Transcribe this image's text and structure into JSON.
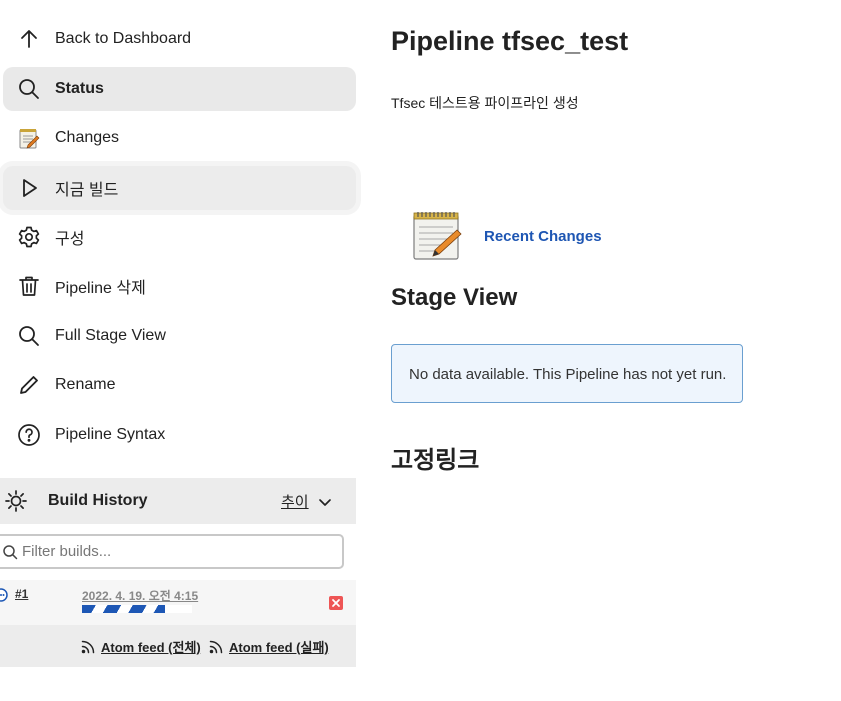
{
  "sidebar": {
    "items": [
      {
        "label": "Back to Dashboard",
        "icon": "arrow-up-icon"
      },
      {
        "label": "Status",
        "icon": "search-icon"
      },
      {
        "label": "Changes",
        "icon": "notepad-icon"
      },
      {
        "label": "지금 빌드",
        "icon": "play-icon"
      },
      {
        "label": "구성",
        "icon": "gear-icon"
      },
      {
        "label": "Pipeline 삭제",
        "icon": "trash-icon"
      },
      {
        "label": "Full Stage View",
        "icon": "search-icon"
      },
      {
        "label": "Rename",
        "icon": "pencil-icon"
      },
      {
        "label": "Pipeline Syntax",
        "icon": "help-icon"
      }
    ]
  },
  "build_history": {
    "title": "Build History",
    "trend_label": "추이",
    "filter_placeholder": "Filter builds...",
    "builds": [
      {
        "number": "#1",
        "date": "2022. 4. 19. 오전 4:15",
        "progress": 0.75
      }
    ],
    "feeds": [
      {
        "label": "Atom feed (전체)"
      },
      {
        "label": "Atom feed (실패)"
      }
    ]
  },
  "main": {
    "title": "Pipeline tfsec_test",
    "description": "Tfsec 테스트용 파이프라인 생성",
    "recent_changes_label": "Recent Changes",
    "stage_view_title": "Stage View",
    "stage_view_message": "No data available. This Pipeline has not yet run.",
    "permalinks_title": "고정링크"
  },
  "colors": {
    "link": "#1e56b3",
    "active_bg": "#e9e9e9",
    "info_border": "#6a9fd0",
    "info_bg": "#eef5fd",
    "progress": "#1d57b5"
  }
}
